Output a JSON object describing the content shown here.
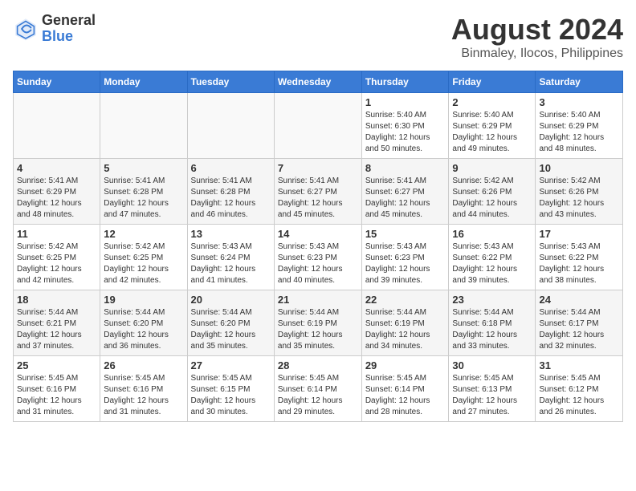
{
  "header": {
    "logo_line1": "General",
    "logo_line2": "Blue",
    "month_year": "August 2024",
    "location": "Binmaley, Ilocos, Philippines"
  },
  "weekdays": [
    "Sunday",
    "Monday",
    "Tuesday",
    "Wednesday",
    "Thursday",
    "Friday",
    "Saturday"
  ],
  "weeks": [
    [
      {
        "day": "",
        "sunrise": "",
        "sunset": "",
        "daylight": ""
      },
      {
        "day": "",
        "sunrise": "",
        "sunset": "",
        "daylight": ""
      },
      {
        "day": "",
        "sunrise": "",
        "sunset": "",
        "daylight": ""
      },
      {
        "day": "",
        "sunrise": "",
        "sunset": "",
        "daylight": ""
      },
      {
        "day": "1",
        "sunrise": "5:40 AM",
        "sunset": "6:30 PM",
        "daylight": "12 hours and 50 minutes."
      },
      {
        "day": "2",
        "sunrise": "5:40 AM",
        "sunset": "6:29 PM",
        "daylight": "12 hours and 49 minutes."
      },
      {
        "day": "3",
        "sunrise": "5:40 AM",
        "sunset": "6:29 PM",
        "daylight": "12 hours and 48 minutes."
      }
    ],
    [
      {
        "day": "4",
        "sunrise": "5:41 AM",
        "sunset": "6:29 PM",
        "daylight": "12 hours and 48 minutes."
      },
      {
        "day": "5",
        "sunrise": "5:41 AM",
        "sunset": "6:28 PM",
        "daylight": "12 hours and 47 minutes."
      },
      {
        "day": "6",
        "sunrise": "5:41 AM",
        "sunset": "6:28 PM",
        "daylight": "12 hours and 46 minutes."
      },
      {
        "day": "7",
        "sunrise": "5:41 AM",
        "sunset": "6:27 PM",
        "daylight": "12 hours and 45 minutes."
      },
      {
        "day": "8",
        "sunrise": "5:41 AM",
        "sunset": "6:27 PM",
        "daylight": "12 hours and 45 minutes."
      },
      {
        "day": "9",
        "sunrise": "5:42 AM",
        "sunset": "6:26 PM",
        "daylight": "12 hours and 44 minutes."
      },
      {
        "day": "10",
        "sunrise": "5:42 AM",
        "sunset": "6:26 PM",
        "daylight": "12 hours and 43 minutes."
      }
    ],
    [
      {
        "day": "11",
        "sunrise": "5:42 AM",
        "sunset": "6:25 PM",
        "daylight": "12 hours and 42 minutes."
      },
      {
        "day": "12",
        "sunrise": "5:42 AM",
        "sunset": "6:25 PM",
        "daylight": "12 hours and 42 minutes."
      },
      {
        "day": "13",
        "sunrise": "5:43 AM",
        "sunset": "6:24 PM",
        "daylight": "12 hours and 41 minutes."
      },
      {
        "day": "14",
        "sunrise": "5:43 AM",
        "sunset": "6:23 PM",
        "daylight": "12 hours and 40 minutes."
      },
      {
        "day": "15",
        "sunrise": "5:43 AM",
        "sunset": "6:23 PM",
        "daylight": "12 hours and 39 minutes."
      },
      {
        "day": "16",
        "sunrise": "5:43 AM",
        "sunset": "6:22 PM",
        "daylight": "12 hours and 39 minutes."
      },
      {
        "day": "17",
        "sunrise": "5:43 AM",
        "sunset": "6:22 PM",
        "daylight": "12 hours and 38 minutes."
      }
    ],
    [
      {
        "day": "18",
        "sunrise": "5:44 AM",
        "sunset": "6:21 PM",
        "daylight": "12 hours and 37 minutes."
      },
      {
        "day": "19",
        "sunrise": "5:44 AM",
        "sunset": "6:20 PM",
        "daylight": "12 hours and 36 minutes."
      },
      {
        "day": "20",
        "sunrise": "5:44 AM",
        "sunset": "6:20 PM",
        "daylight": "12 hours and 35 minutes."
      },
      {
        "day": "21",
        "sunrise": "5:44 AM",
        "sunset": "6:19 PM",
        "daylight": "12 hours and 35 minutes."
      },
      {
        "day": "22",
        "sunrise": "5:44 AM",
        "sunset": "6:19 PM",
        "daylight": "12 hours and 34 minutes."
      },
      {
        "day": "23",
        "sunrise": "5:44 AM",
        "sunset": "6:18 PM",
        "daylight": "12 hours and 33 minutes."
      },
      {
        "day": "24",
        "sunrise": "5:44 AM",
        "sunset": "6:17 PM",
        "daylight": "12 hours and 32 minutes."
      }
    ],
    [
      {
        "day": "25",
        "sunrise": "5:45 AM",
        "sunset": "6:16 PM",
        "daylight": "12 hours and 31 minutes."
      },
      {
        "day": "26",
        "sunrise": "5:45 AM",
        "sunset": "6:16 PM",
        "daylight": "12 hours and 31 minutes."
      },
      {
        "day": "27",
        "sunrise": "5:45 AM",
        "sunset": "6:15 PM",
        "daylight": "12 hours and 30 minutes."
      },
      {
        "day": "28",
        "sunrise": "5:45 AM",
        "sunset": "6:14 PM",
        "daylight": "12 hours and 29 minutes."
      },
      {
        "day": "29",
        "sunrise": "5:45 AM",
        "sunset": "6:14 PM",
        "daylight": "12 hours and 28 minutes."
      },
      {
        "day": "30",
        "sunrise": "5:45 AM",
        "sunset": "6:13 PM",
        "daylight": "12 hours and 27 minutes."
      },
      {
        "day": "31",
        "sunrise": "5:45 AM",
        "sunset": "6:12 PM",
        "daylight": "12 hours and 26 minutes."
      }
    ]
  ]
}
